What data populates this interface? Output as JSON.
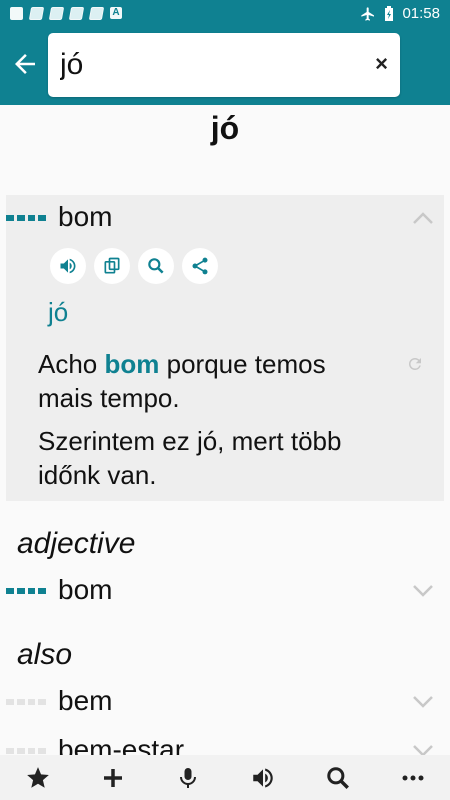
{
  "status_bar": {
    "time": "01:58"
  },
  "search": {
    "value": "jó"
  },
  "headword": "jó",
  "entry": {
    "word": "bom",
    "translation": "jó",
    "example_pre": "Acho ",
    "example_bold": "bom",
    "example_post": " porque temos mais tempo.",
    "example_translation": "Szerintem ez jó, mert több időnk van."
  },
  "sections": [
    {
      "pos": "adjective",
      "words": [
        "bom"
      ]
    },
    {
      "pos": "also",
      "words": [
        "bem",
        "bem-estar"
      ]
    }
  ],
  "icons": {
    "status": [
      "image-icon",
      "book-icon",
      "book-icon",
      "book-icon",
      "book-icon",
      "font-icon",
      "airplane-icon",
      "battery-charging-icon"
    ],
    "entry_actions": [
      "speaker-icon",
      "copy-icon",
      "search-icon",
      "share-icon"
    ],
    "bottom_bar": [
      "star-icon",
      "plus-icon",
      "microphone-icon",
      "speaker-icon",
      "search-icon",
      "more-icon"
    ]
  },
  "colors": {
    "accent": "#0f8191",
    "card_bg": "#eeeeee",
    "background": "#fafafa"
  }
}
